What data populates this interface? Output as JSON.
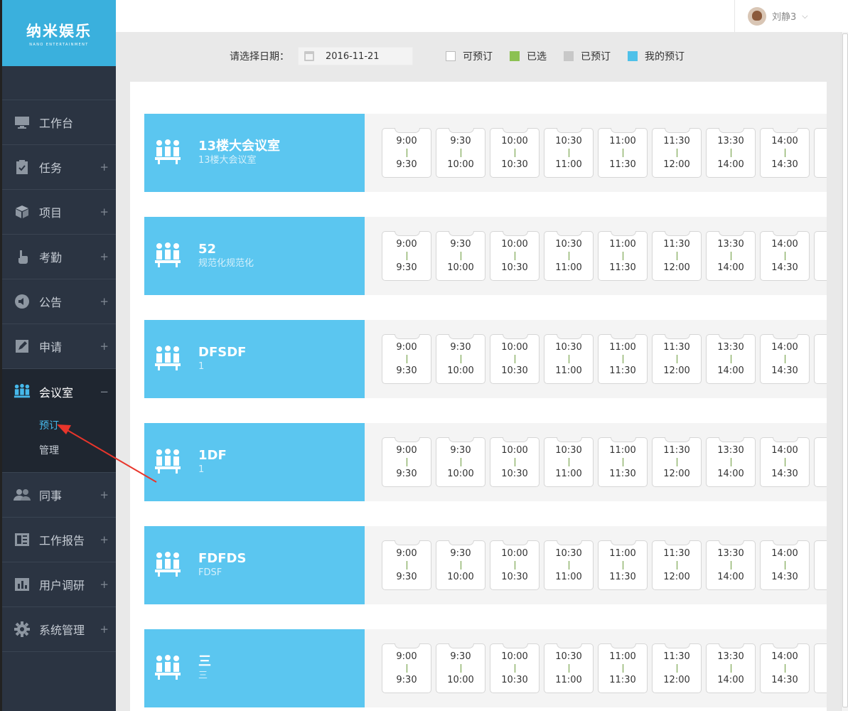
{
  "brand": {
    "name": "纳米娱乐",
    "tagline": "NANO ENTERTAINMENT"
  },
  "user": {
    "name": "刘静3"
  },
  "sidebar": {
    "items": [
      {
        "label": "工作台",
        "icon": "monitor-icon",
        "expandable": false
      },
      {
        "label": "任务",
        "icon": "clipboard-icon",
        "expandable": true
      },
      {
        "label": "项目",
        "icon": "cube-icon",
        "expandable": true
      },
      {
        "label": "考勤",
        "icon": "hand-pointer-icon",
        "expandable": true
      },
      {
        "label": "公告",
        "icon": "speaker-icon",
        "expandable": true
      },
      {
        "label": "申请",
        "icon": "edit-icon",
        "expandable": true
      },
      {
        "label": "会议室",
        "icon": "meeting-icon",
        "expandable": true,
        "expanded": true,
        "children": [
          {
            "label": "预订",
            "current": true
          },
          {
            "label": "管理"
          }
        ]
      },
      {
        "label": "同事",
        "icon": "users-icon",
        "expandable": true
      },
      {
        "label": "工作报告",
        "icon": "report-icon",
        "expandable": true
      },
      {
        "label": "用户调研",
        "icon": "bar-chart-icon",
        "expandable": true
      },
      {
        "label": "系统管理",
        "icon": "gear-icon",
        "expandable": true
      }
    ],
    "plus": "+",
    "minus": "−"
  },
  "filter": {
    "date_label": "请选择日期：",
    "date_value": "2016-11-21"
  },
  "legend": [
    {
      "label": "可预订",
      "color": "#ffffff",
      "border": "#bbbbbb"
    },
    {
      "label": "已选",
      "color": "#8cc152",
      "border": "#8cc152"
    },
    {
      "label": "已预订",
      "color": "#c8c8c8",
      "border": "#c8c8c8"
    },
    {
      "label": "我的预订",
      "color": "#4fc1e9",
      "border": "#4fc1e9"
    }
  ],
  "slots": [
    {
      "start": "9:00",
      "end": "9:30"
    },
    {
      "start": "9:30",
      "end": "10:00"
    },
    {
      "start": "10:00",
      "end": "10:30"
    },
    {
      "start": "10:30",
      "end": "11:00"
    },
    {
      "start": "11:00",
      "end": "11:30"
    },
    {
      "start": "11:30",
      "end": "12:00"
    },
    {
      "start": "13:30",
      "end": "14:00"
    },
    {
      "start": "14:00",
      "end": "14:30"
    }
  ],
  "rooms": [
    {
      "name": "13楼大会议室",
      "desc": "13楼大会议室"
    },
    {
      "name": "52",
      "desc": "规范化规范化"
    },
    {
      "name": "DFSDF",
      "desc": "1"
    },
    {
      "name": "1DF",
      "desc": "1"
    },
    {
      "name": "FDFDS",
      "desc": "FDSF"
    },
    {
      "name": "三",
      "desc": "三"
    }
  ]
}
